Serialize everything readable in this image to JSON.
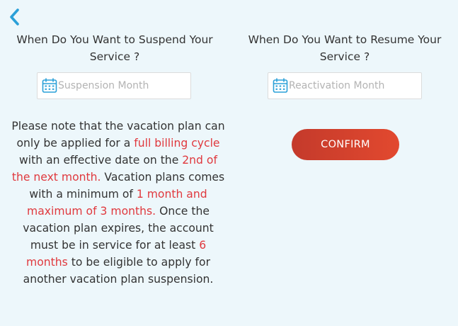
{
  "colors": {
    "background": "#edf7fb",
    "accent_blue": "#2aa0d8",
    "highlight_red": "#e0393e",
    "button_gradient_start": "#c43a2b",
    "button_gradient_end": "#e2492f"
  },
  "back": {
    "icon": "chevron-left-icon"
  },
  "suspend": {
    "heading_line1": "When Do You Want to Suspend Your",
    "heading_line2": "Service ?",
    "placeholder": "Suspension Month",
    "icon": "calendar-icon"
  },
  "resume": {
    "heading_line1": "When Do You Want to Resume Your",
    "heading_line2": "Service ?",
    "placeholder": "Reactivation Month",
    "icon": "calendar-icon"
  },
  "note": {
    "text1": "Please note that the vacation plan can only be applied for a ",
    "hl1": "full billing cycle",
    "text2": " with an effective date on the ",
    "hl2": "2nd of the next month.",
    "text3": " Vacation plans comes with a minimum of ",
    "hl3": "1 month and maximum of 3 months.",
    "text4": " Once the vacation plan expires, the account must be in service for at least ",
    "hl4": "6 months",
    "text5": " to be eligible to apply for another vacation plan suspension."
  },
  "confirm_label": "CONFIRM"
}
